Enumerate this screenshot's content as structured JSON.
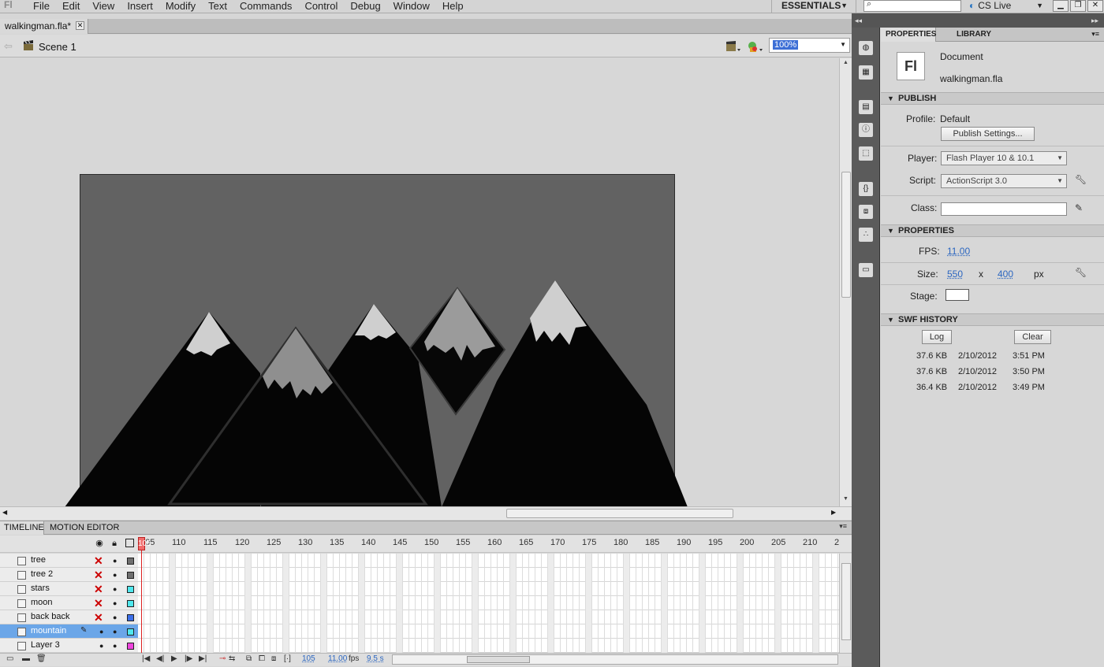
{
  "menubar": {
    "logo": "Fl",
    "items": [
      "File",
      "Edit",
      "View",
      "Insert",
      "Modify",
      "Text",
      "Commands",
      "Control",
      "Debug",
      "Window",
      "Help"
    ],
    "workspace": "ESSENTIALS",
    "search_placeholder": "",
    "cslive": "CS Live"
  },
  "document": {
    "tab_label": "walkingman.fla*",
    "scene_label": "Scene 1",
    "zoom": "100%"
  },
  "timeline": {
    "tabs": [
      "TIMELINE",
      "MOTION EDITOR"
    ],
    "ruler": [
      "105",
      "110",
      "115",
      "120",
      "125",
      "130",
      "135",
      "140",
      "145",
      "150",
      "155",
      "160",
      "165",
      "170",
      "175",
      "180",
      "185",
      "190",
      "195",
      "200",
      "205",
      "210",
      "2"
    ],
    "playhead_frame": "105",
    "layers": [
      {
        "name": "tree",
        "hidden": true,
        "color": "#6f6f6f"
      },
      {
        "name": "tree 2",
        "hidden": true,
        "color": "#6f6f6f"
      },
      {
        "name": "stars",
        "hidden": true,
        "color": "#4fe8ee"
      },
      {
        "name": "moon",
        "hidden": true,
        "color": "#4fe8ee"
      },
      {
        "name": "back back",
        "hidden": true,
        "color": "#3c6fe8"
      },
      {
        "name": "mountain",
        "hidden": false,
        "color": "#4fe8ee",
        "selected": true
      },
      {
        "name": "Layer 3",
        "hidden": false,
        "color": "#ee44dd"
      }
    ],
    "footer": {
      "current_frame": "105",
      "fps": "11.00",
      "fps_unit": "fps",
      "time": "9.5 s"
    }
  },
  "properties": {
    "tabs": [
      "PROPERTIES",
      "LIBRARY"
    ],
    "doc_icon": "Fl",
    "doc_type": "Document",
    "doc_name": "walkingman.fla",
    "publish": {
      "header": "PUBLISH",
      "profile_label": "Profile:",
      "profile_value": "Default",
      "settings_button": "Publish Settings...",
      "player_label": "Player:",
      "player_value": "Flash Player 10 & 10.1",
      "script_label": "Script:",
      "script_value": "ActionScript 3.0",
      "class_label": "Class:",
      "class_value": ""
    },
    "props": {
      "header": "PROPERTIES",
      "fps_label": "FPS:",
      "fps_value": "11.00",
      "size_label": "Size:",
      "width": "550",
      "x": "x",
      "height": "400",
      "unit": "px",
      "stage_label": "Stage:",
      "stage_color": "#ffffff"
    },
    "history": {
      "header": "SWF HISTORY",
      "log_button": "Log",
      "clear_button": "Clear",
      "rows": [
        {
          "size": "37.6 KB",
          "date": "2/10/2012",
          "time": "3:51 PM"
        },
        {
          "size": "37.6 KB",
          "date": "2/10/2012",
          "time": "3:50 PM"
        },
        {
          "size": "36.4 KB",
          "date": "2/10/2012",
          "time": "3:49 PM"
        }
      ]
    }
  }
}
